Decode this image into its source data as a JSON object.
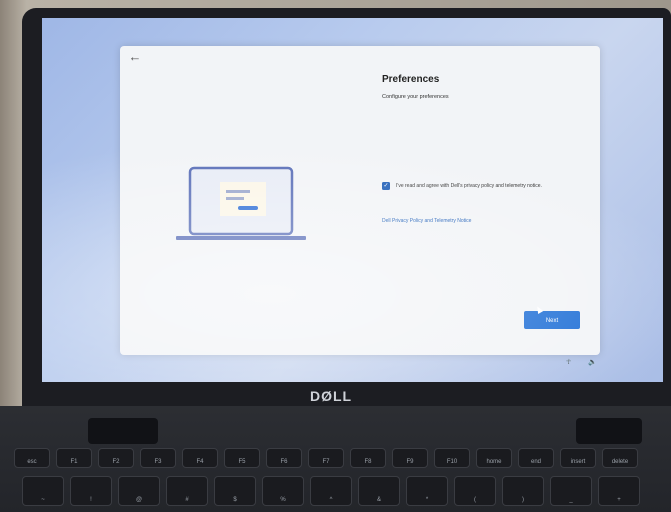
{
  "setup": {
    "title": "Preferences",
    "subtitle": "Configure your preferences",
    "consent_text": "I've read and agree with Dell's privacy policy and telemetry notice.",
    "consent_checked": true,
    "policy_link": "Dell Privacy Policy and Telemetry Notice",
    "next_label": "Next",
    "back_icon": "←"
  },
  "bezel": {
    "logo": "DØLL"
  },
  "tray": {
    "accessibility_icon": "☥",
    "volume_icon": "🔈"
  },
  "keyboard": {
    "row1": [
      "esc",
      "F1",
      "F2",
      "F3",
      "F4",
      "F5",
      "F6",
      "F7",
      "F8",
      "F9",
      "F10",
      "home",
      "end",
      "insert",
      "delete"
    ],
    "row2": [
      "~",
      "!",
      "@",
      "#",
      "$",
      "%",
      "^",
      "&",
      "*",
      "(",
      ")",
      "_",
      "+"
    ]
  }
}
